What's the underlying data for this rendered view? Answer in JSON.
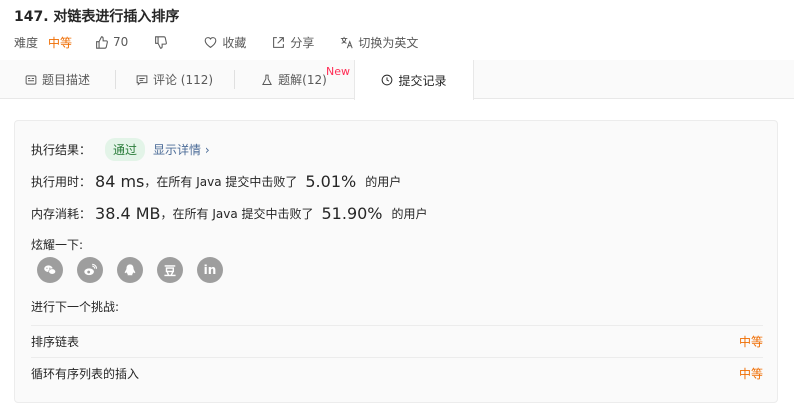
{
  "problem": {
    "title": "147. 对链表进行插入排序",
    "difficulty_label": "难度",
    "difficulty_value": "中等",
    "likes": "70",
    "collect_label": "收藏",
    "share_label": "分享",
    "switch_lang_label": "切换为英文"
  },
  "tabs": [
    {
      "label": "题目描述",
      "icon": "description-icon"
    },
    {
      "label": "评论 (112)",
      "icon": "comment-icon"
    },
    {
      "label": "题解(12)",
      "icon": "flask-icon",
      "badge": "New"
    },
    {
      "label": "提交记录",
      "icon": "clock-icon",
      "active": true
    }
  ],
  "result": {
    "label": "执行结果：",
    "status": "通过",
    "details_link": "显示详情 ›"
  },
  "runtime": {
    "label": "执行用时：",
    "value": "84 ms",
    "text": "，在所有 Java 提交中击败了",
    "percent": "5.01%",
    "suffix": "的用户"
  },
  "memory": {
    "label": "内存消耗：",
    "value": "38.4 MB",
    "text": "，在所有 Java 提交中击败了",
    "percent": "51.90%",
    "suffix": "的用户"
  },
  "share": {
    "label": "炫耀一下:",
    "platforms": [
      {
        "name": "wechat-icon"
      },
      {
        "name": "weibo-icon"
      },
      {
        "name": "qq-icon"
      },
      {
        "name": "douban-icon",
        "glyph": "豆"
      },
      {
        "name": "linkedin-icon",
        "glyph": "in"
      }
    ]
  },
  "next_challenge": {
    "label": "进行下一个挑战:",
    "items": [
      {
        "name": "排序链表",
        "difficulty": "中等"
      },
      {
        "name": "循环有序列表的插入",
        "difficulty": "中等"
      }
    ]
  },
  "colors": {
    "medium": "#ef6c00",
    "pass_bg": "#e3f4e8",
    "pass_text": "#2a7c3a",
    "link": "#4c6c98",
    "new_badge": "#ff2d55"
  }
}
